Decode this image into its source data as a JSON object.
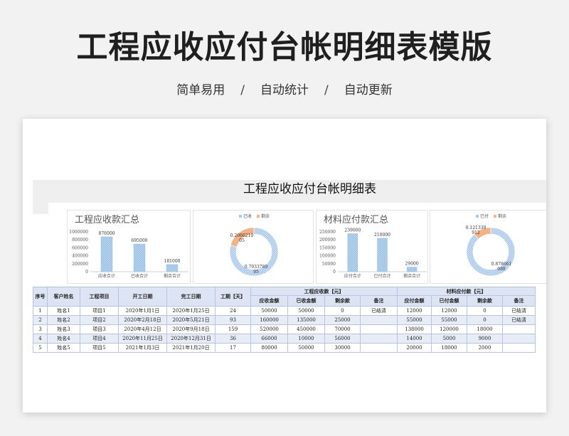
{
  "hero": {
    "title": "工程应收应付台帐明细表模版",
    "features": [
      "简单易用",
      "自动统计",
      "自动更新"
    ],
    "separator": "/"
  },
  "sheet": {
    "title": "工程应收应付台帐明细表"
  },
  "colors": {
    "bar": "#9dc3e6",
    "received": "#a8c8ec",
    "remaining": "#f4b183",
    "header_bg": "#dde4f4",
    "row_alt": "#e7ecf7"
  },
  "chart_data": [
    {
      "type": "bar",
      "title": "工程应收款汇总",
      "categories": [
        "应收合计",
        "已收合计",
        "剩余合计"
      ],
      "values": [
        876000,
        695000,
        181000
      ],
      "data_labels": [
        "876000",
        "695000",
        "181000"
      ],
      "yticks": [
        "1000000",
        "800000",
        "600000",
        "400000",
        "200000",
        "0"
      ],
      "ylim": [
        0,
        1000000
      ],
      "grid": false
    },
    {
      "type": "pie",
      "donut": true,
      "legend": [
        "已收",
        "剩余"
      ],
      "legend_position": "top",
      "values": [
        0.7933789954,
        0.2066210046
      ],
      "data_labels": [
        "0.7933789\n95",
        "0.2066210\n05"
      ]
    },
    {
      "type": "bar",
      "title": "材料应付款汇总",
      "categories": [
        "应付合计",
        "已付合计",
        "剩余合计"
      ],
      "values": [
        239000,
        210000,
        29000
      ],
      "data_labels": [
        "239000",
        "210000",
        "29000"
      ],
      "yticks": [
        "250000",
        "200000",
        "150000",
        "100000",
        "50000",
        "0"
      ],
      "ylim": [
        0,
        250000
      ],
      "grid": false
    },
    {
      "type": "pie",
      "donut": true,
      "legend": [
        "已付",
        "剩余"
      ],
      "legend_position": "top",
      "values": [
        0.878661088,
        0.121338912
      ],
      "data_labels": [
        "0.121338\n912",
        "0.878661\n088"
      ]
    }
  ],
  "table": {
    "fixed_headers": [
      "序号",
      "客户姓名",
      "工程项目",
      "开工日期",
      "完工日期",
      "工期【天】"
    ],
    "group_receivable": "工程应收款【元】",
    "group_payable": "材料应付款【元】",
    "sub_receivable": [
      "应收金额",
      "已收金额",
      "剩余款",
      "备注"
    ],
    "sub_payable": [
      "应付金额",
      "已付金额",
      "剩余款",
      "备注"
    ],
    "rows": [
      [
        "1",
        "姓名1",
        "项目1",
        "2020年1月1日",
        "2020年1月25日",
        "24",
        "50000",
        "50000",
        "0",
        "已结清",
        "12000",
        "12000",
        "0",
        "已结清"
      ],
      [
        "2",
        "姓名2",
        "项目2",
        "2020年2月18日",
        "2020年5月21日",
        "93",
        "160000",
        "135000",
        "25000",
        "",
        "55000",
        "55000",
        "0",
        "已结清"
      ],
      [
        "3",
        "姓名3",
        "项目3",
        "2020年4月12日",
        "2020年9月18日",
        "159",
        "520000",
        "450000",
        "70000",
        "",
        "138000",
        "120000",
        "18000",
        ""
      ],
      [
        "4",
        "姓名4",
        "项目4",
        "2020年11月25日",
        "2020年12月31日",
        "36",
        "66000",
        "10000",
        "56000",
        "",
        "14000",
        "5000",
        "9000",
        ""
      ],
      [
        "5",
        "姓名5",
        "项目5",
        "2021年1月3日",
        "2021年1月20日",
        "17",
        "80000",
        "50000",
        "30000",
        "",
        "20000",
        "18000",
        "2000",
        ""
      ]
    ]
  }
}
